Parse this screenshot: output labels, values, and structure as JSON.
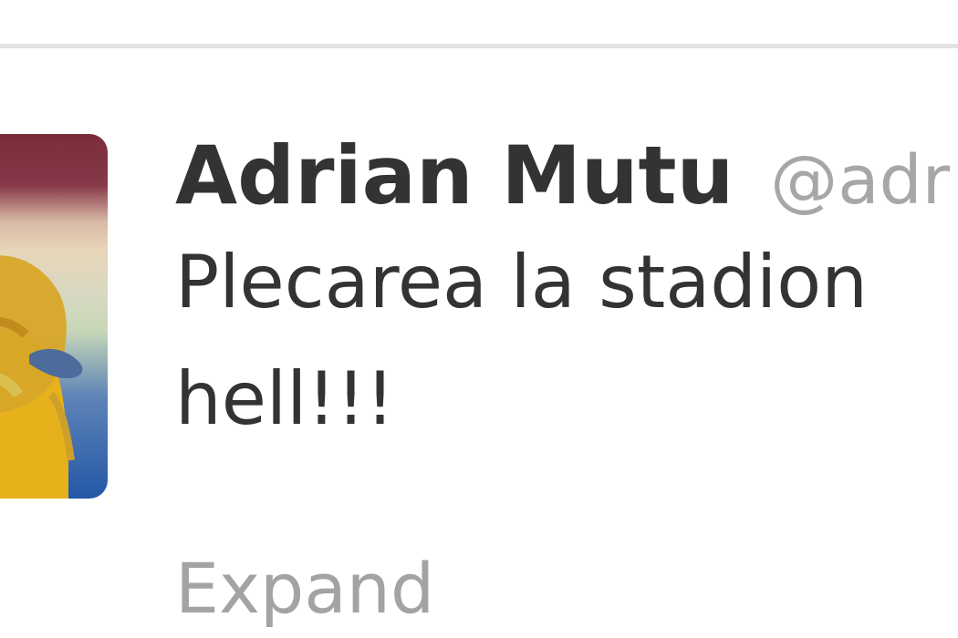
{
  "tweet": {
    "display_name": "Adrian Mutu",
    "screen_name": "@adr",
    "text_line_1": "Plecarea la stadion",
    "text_line_2": "hell!!!",
    "expand_label": "Expand",
    "avatar_icon": "user-avatar-photo"
  },
  "colors": {
    "divider": "#e3e3e3",
    "text": "#333333",
    "muted": "#a7a7a7"
  }
}
